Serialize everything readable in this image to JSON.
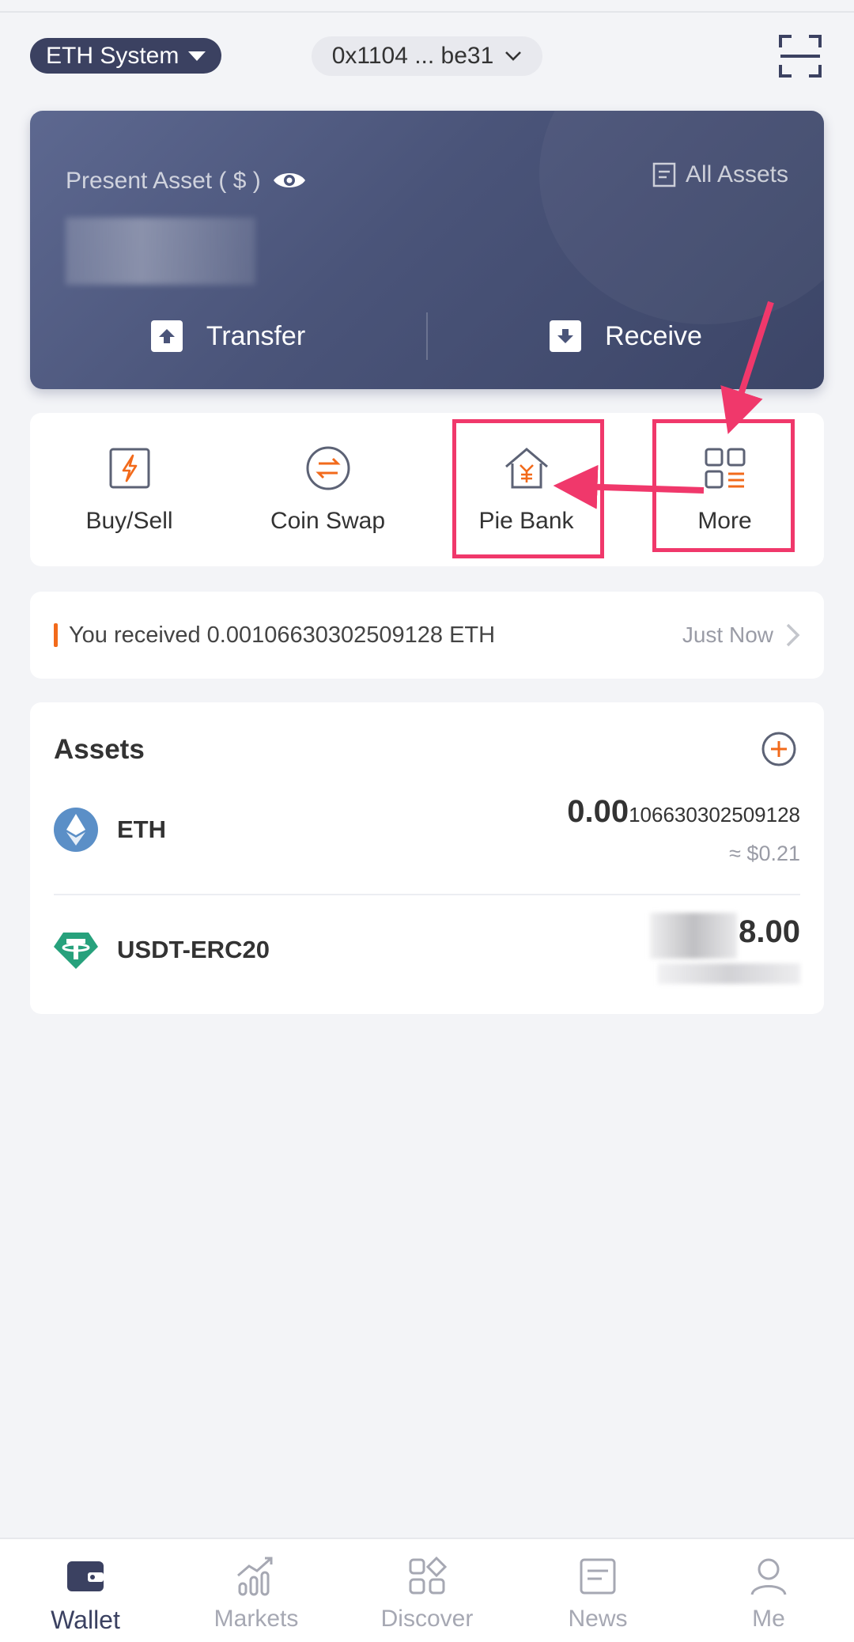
{
  "header": {
    "network": "ETH System",
    "address": "0x1104 ... be31"
  },
  "asset_card": {
    "label": "Present Asset ( $ )",
    "all_assets": "All Assets",
    "transfer": "Transfer",
    "receive": "Receive"
  },
  "quick_actions": [
    {
      "label": "Buy/Sell"
    },
    {
      "label": "Coin Swap"
    },
    {
      "label": "Pie Bank"
    },
    {
      "label": "More"
    }
  ],
  "notice": {
    "text": "You received 0.00106630302509128 ETH",
    "time": "Just Now"
  },
  "assets": {
    "title": "Assets",
    "rows": [
      {
        "name": "ETH",
        "balance_main": "0.00",
        "balance_decimals": "106630302509128",
        "fiat": "≈ $0.21"
      },
      {
        "name": "USDT-ERC20",
        "balance_visible": "8.00"
      }
    ]
  },
  "tabs": [
    {
      "label": "Wallet"
    },
    {
      "label": "Markets"
    },
    {
      "label": "Discover"
    },
    {
      "label": "News"
    },
    {
      "label": "Me"
    }
  ],
  "colors": {
    "primary": "#3b4161",
    "accent": "#f26a1b",
    "highlight": "#f0386b",
    "eth": "#5b8fc7",
    "usdt": "#27a17c"
  }
}
